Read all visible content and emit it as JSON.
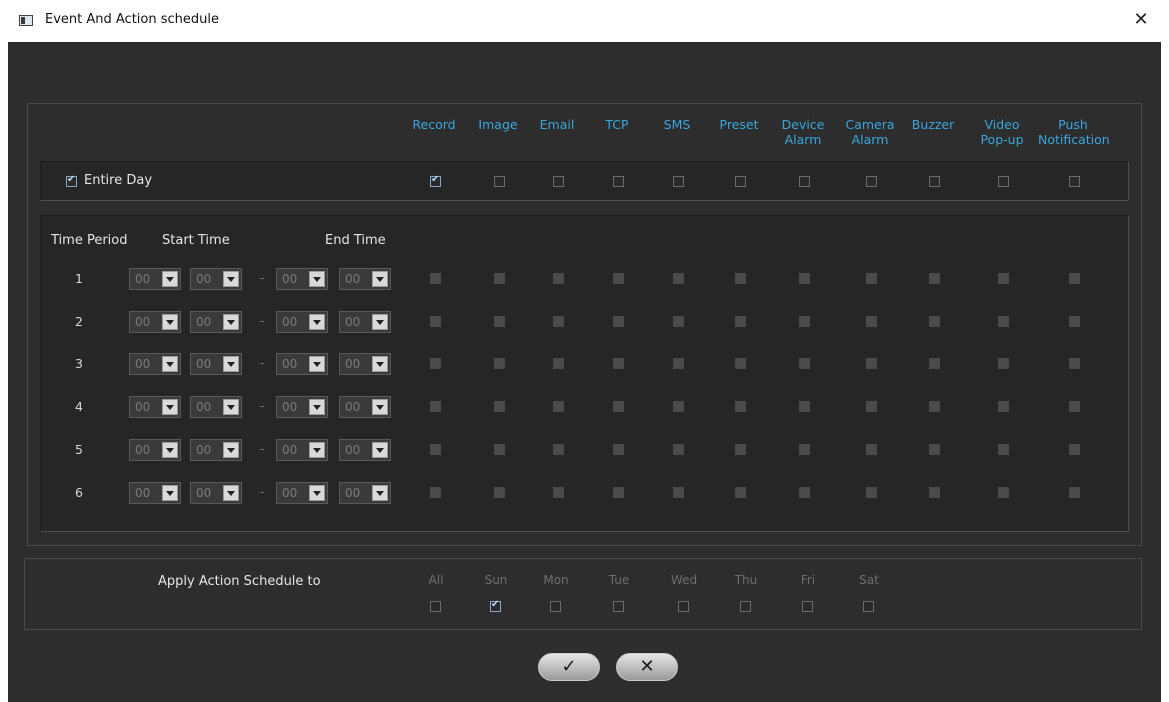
{
  "window": {
    "title": "Event And Action schedule",
    "close_glyph": "✕"
  },
  "columns": [
    {
      "label": "Record",
      "label2": ""
    },
    {
      "label": "Image",
      "label2": ""
    },
    {
      "label": "Email",
      "label2": ""
    },
    {
      "label": "TCP",
      "label2": ""
    },
    {
      "label": "SMS",
      "label2": ""
    },
    {
      "label": "Preset",
      "label2": ""
    },
    {
      "label": "Device",
      "label2": "Alarm"
    },
    {
      "label": "Camera",
      "label2": "Alarm"
    },
    {
      "label": "Buzzer",
      "label2": ""
    },
    {
      "label": "Video",
      "label2": "Pop-up"
    },
    {
      "label": "Push",
      "label2": "Notification"
    }
  ],
  "entire_day": {
    "label": "Entire Day",
    "checked": true,
    "actions_checked": [
      true,
      false,
      false,
      false,
      false,
      false,
      false,
      false,
      false,
      false,
      false
    ]
  },
  "period_headers": {
    "time_period": "Time Period",
    "start_time": "Start Time",
    "end_time": "End Time"
  },
  "periods": [
    {
      "num": "1",
      "start_h": "00",
      "start_m": "00",
      "end_h": "00",
      "end_m": "00"
    },
    {
      "num": "2",
      "start_h": "00",
      "start_m": "00",
      "end_h": "00",
      "end_m": "00"
    },
    {
      "num": "3",
      "start_h": "00",
      "start_m": "00",
      "end_h": "00",
      "end_m": "00"
    },
    {
      "num": "4",
      "start_h": "00",
      "start_m": "00",
      "end_h": "00",
      "end_m": "00"
    },
    {
      "num": "5",
      "start_h": "00",
      "start_m": "00",
      "end_h": "00",
      "end_m": "00"
    },
    {
      "num": "6",
      "start_h": "00",
      "start_m": "00",
      "end_h": "00",
      "end_m": "00"
    }
  ],
  "time_separator": "-",
  "apply": {
    "label": "Apply Action Schedule to",
    "days": [
      {
        "label": "All",
        "checked": false
      },
      {
        "label": "Sun",
        "checked": true
      },
      {
        "label": "Mon",
        "checked": false
      },
      {
        "label": "Tue",
        "checked": false
      },
      {
        "label": "Wed",
        "checked": false
      },
      {
        "label": "Thu",
        "checked": false
      },
      {
        "label": "Fri",
        "checked": false
      },
      {
        "label": "Sat",
        "checked": false
      }
    ]
  },
  "buttons": {
    "ok_glyph": "✓",
    "cancel_glyph": "✕"
  },
  "colors": {
    "header_blue": "#39a6dd",
    "background": "#2d2d2d"
  }
}
